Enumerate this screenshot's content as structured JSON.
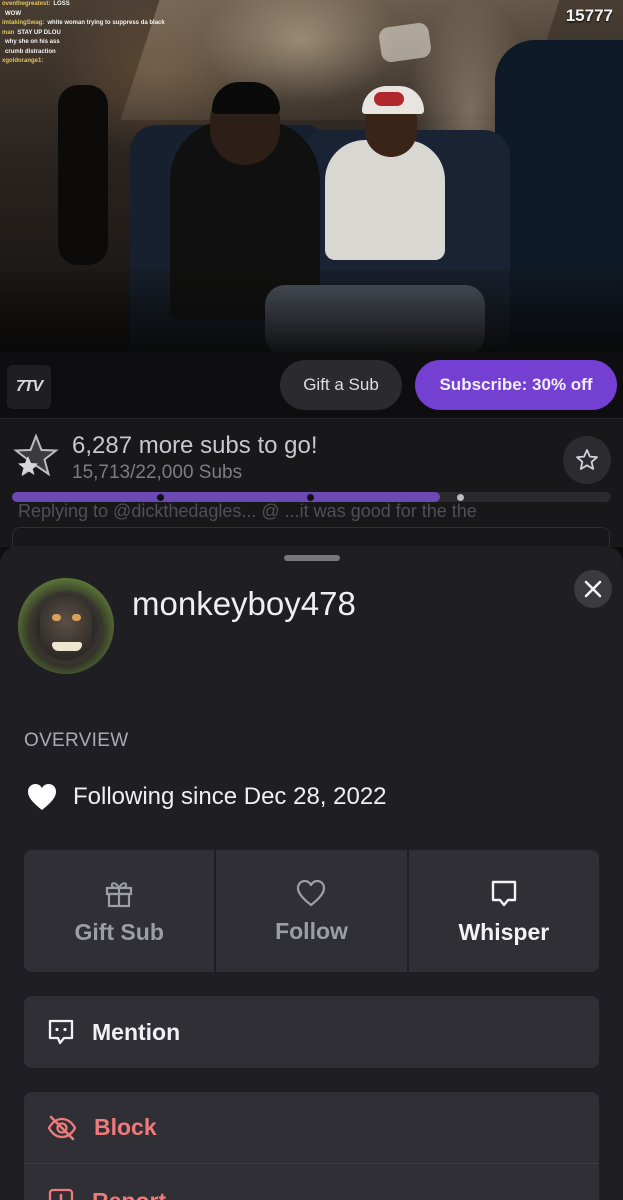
{
  "video": {
    "viewer_count": "15777",
    "chat": [
      {
        "user": "oventhegreatest:",
        "msg": "LOSS"
      },
      {
        "user": "",
        "msg": "WOW"
      },
      {
        "user": "imtakingSwag:",
        "msg": "white woman trying to suppress da black"
      },
      {
        "user": "man",
        "msg": "STAY UP DLOU"
      },
      {
        "user": "",
        "msg": "why she on his ass"
      },
      {
        "user": "",
        "msg": "crumb distraction"
      },
      {
        "user": "xgoldorange1:",
        "msg": ""
      },
      {
        "user": "",
        "msg": ""
      }
    ]
  },
  "action_bar": {
    "extension_icon": "7TV",
    "gift_label": "Gift a Sub",
    "subscribe_label": "Subscribe: 30% off",
    "accent_color": "#7440d1"
  },
  "sub_goal": {
    "title": "6,287 more subs to go!",
    "progress_text": "15,713/22,000 Subs",
    "current": 15713,
    "target": 22000,
    "progress_fraction": 0.714,
    "reply_preview": "Replying to @dickthedagles... @ ...it was good for the the"
  },
  "profile": {
    "username": "monkeyboy478",
    "overview_label": "OVERVIEW",
    "following_text": "Following since Dec 28, 2022",
    "actions": [
      {
        "label": "Gift Sub",
        "icon": "gift-icon"
      },
      {
        "label": "Follow",
        "icon": "heart-outline-icon"
      },
      {
        "label": "Whisper",
        "icon": "whisper-icon"
      }
    ],
    "mention_label": "Mention",
    "block_label": "Block",
    "report_label": "Report",
    "danger_color": "#f07a7a"
  }
}
